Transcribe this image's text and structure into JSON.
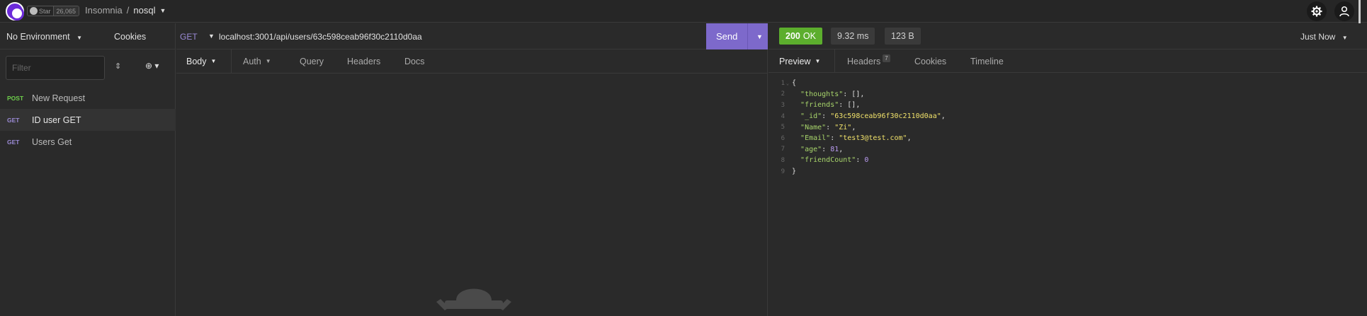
{
  "topbar": {
    "github_star_label": "Star",
    "github_star_count": "26,065",
    "breadcrumb_parent": "Insomnia",
    "breadcrumb_separator": "/",
    "breadcrumb_current": "nosql",
    "caret": "▼",
    "settings_icon": "gear-icon",
    "account_icon": "user-icon"
  },
  "sidebar": {
    "environment": "No Environment",
    "env_caret": "▼",
    "cookies_label": "Cookies",
    "filter_placeholder": "Filter",
    "sort_glyph": "⇕",
    "add_glyph": "⊕ ▾",
    "requests": [
      {
        "method": "POST",
        "name": "New Request",
        "active": false
      },
      {
        "method": "GET",
        "name": "ID user GET",
        "active": true
      },
      {
        "method": "GET",
        "name": "Users Get",
        "active": false
      }
    ]
  },
  "request": {
    "method": "GET",
    "url": "localhost:3001/api/users/63c598ceab96f30c2110d0aa",
    "send_label": "Send",
    "send_caret": "▼",
    "tabs": [
      {
        "label": "Body",
        "active": true,
        "caret": "▼"
      },
      {
        "label": "Auth",
        "active": false,
        "caret": "▼"
      },
      {
        "label": "Query",
        "active": false
      },
      {
        "label": "Headers",
        "active": false
      },
      {
        "label": "Docs",
        "active": false
      }
    ]
  },
  "response": {
    "status_code": "200",
    "status_text": "OK",
    "time": "9.32 ms",
    "size": "123 B",
    "history_label": "Just Now",
    "history_caret": "▼",
    "tabs": [
      {
        "label": "Preview",
        "active": true,
        "caret": "▼"
      },
      {
        "label": "Headers",
        "badge": "7"
      },
      {
        "label": "Cookies"
      },
      {
        "label": "Timeline"
      }
    ],
    "body_lines": [
      {
        "n": "1",
        "fold": "⌄",
        "tokens": [
          [
            "p",
            "{"
          ]
        ]
      },
      {
        "n": "2",
        "tokens": [
          [
            "p",
            "  "
          ],
          [
            "k",
            "\"thoughts\""
          ],
          [
            "p",
            ": [],"
          ]
        ]
      },
      {
        "n": "3",
        "tokens": [
          [
            "p",
            "  "
          ],
          [
            "k",
            "\"friends\""
          ],
          [
            "p",
            ": [],"
          ]
        ]
      },
      {
        "n": "4",
        "tokens": [
          [
            "p",
            "  "
          ],
          [
            "k",
            "\"_id\""
          ],
          [
            "p",
            ": "
          ],
          [
            "s",
            "\"63c598ceab96f30c2110d0aa\""
          ],
          [
            "p",
            ","
          ]
        ]
      },
      {
        "n": "5",
        "tokens": [
          [
            "p",
            "  "
          ],
          [
            "k",
            "\"Name\""
          ],
          [
            "p",
            ": "
          ],
          [
            "s",
            "\"Zi\""
          ],
          [
            "p",
            ","
          ]
        ]
      },
      {
        "n": "6",
        "tokens": [
          [
            "p",
            "  "
          ],
          [
            "k",
            "\"Email\""
          ],
          [
            "p",
            ": "
          ],
          [
            "s",
            "\"test3@test.com\""
          ],
          [
            "p",
            ","
          ]
        ]
      },
      {
        "n": "7",
        "tokens": [
          [
            "p",
            "  "
          ],
          [
            "k",
            "\"age\""
          ],
          [
            "p",
            ": "
          ],
          [
            "n",
            "81"
          ],
          [
            "p",
            ","
          ]
        ]
      },
      {
        "n": "8",
        "tokens": [
          [
            "p",
            "  "
          ],
          [
            "k",
            "\"friendCount\""
          ],
          [
            "p",
            ": "
          ],
          [
            "n",
            "0"
          ]
        ]
      },
      {
        "n": "9",
        "tokens": [
          [
            "p",
            "}"
          ]
        ]
      }
    ]
  },
  "colors": {
    "accent": "#7d69cb",
    "ok": "#5cae2d",
    "post": "#6ed04b",
    "get": "#9b8bd6"
  }
}
